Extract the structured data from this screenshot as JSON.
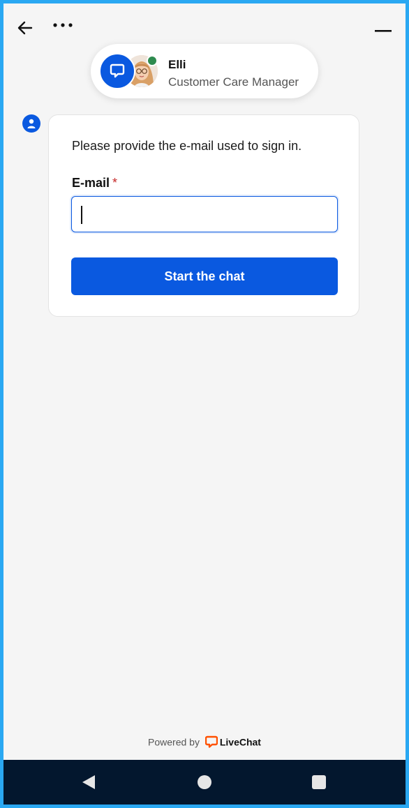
{
  "header": {
    "back_icon": "arrow-left-icon",
    "more_icon": "more-horizontal-icon",
    "minimize_icon": "minimize-icon"
  },
  "agent": {
    "name": "Elli",
    "role": "Customer Care Manager",
    "status": "online",
    "status_color": "#2e8b4f"
  },
  "form": {
    "prompt": "Please provide the e-mail used to sign in.",
    "email_label": "E-mail",
    "required_mark": "*",
    "email_value": "",
    "submit_label": "Start the chat"
  },
  "footer": {
    "powered_by": "Powered by",
    "brand": "LiveChat"
  },
  "colors": {
    "accent": "#0a59e0",
    "frame": "#2aa8f2",
    "background": "#f5f5f5",
    "navbar": "#03172e",
    "brand_logo": "#ff5100"
  }
}
